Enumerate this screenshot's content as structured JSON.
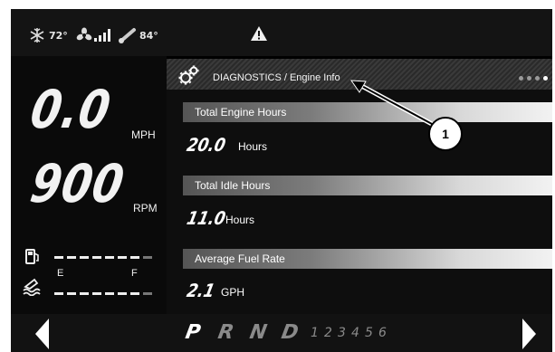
{
  "status": {
    "temp_left": "72°",
    "temp_right": "84°",
    "icons": [
      "snowflake-icon",
      "fan-icon",
      "signal-bars-icon",
      "thermometer-icon",
      "warning-icon"
    ]
  },
  "speed": {
    "value": "0.0",
    "unit": "MPH"
  },
  "rpm": {
    "value": "900",
    "unit": "RPM"
  },
  "fuel": {
    "empty_label": "E",
    "full_label": "F",
    "icons": [
      "fuel-pump-icon",
      "engine-coolant-icon"
    ]
  },
  "header": {
    "title": "DIAGNOSTICS / Engine Info",
    "page_dots": 4,
    "active_dot": 4
  },
  "metrics": [
    {
      "label": "Total Engine Hours",
      "value": "20.0",
      "unit": "Hours"
    },
    {
      "label": "Total Idle Hours",
      "value": "11.0",
      "unit": "Hours"
    },
    {
      "label": "Average Fuel Rate",
      "value": "2.1",
      "unit": "GPH"
    }
  ],
  "gears": {
    "letters": [
      "P",
      "R",
      "N",
      "D"
    ],
    "numbers": [
      "1",
      "2",
      "3",
      "4",
      "5",
      "6"
    ],
    "selected": "P"
  },
  "callout": {
    "number": "1"
  },
  "colors": {
    "background": "#000000",
    "text": "#ffffff",
    "bar_light": "#f2f2f2",
    "bar_dark": "#555555",
    "inactive_gear": "#8a8a8a"
  }
}
